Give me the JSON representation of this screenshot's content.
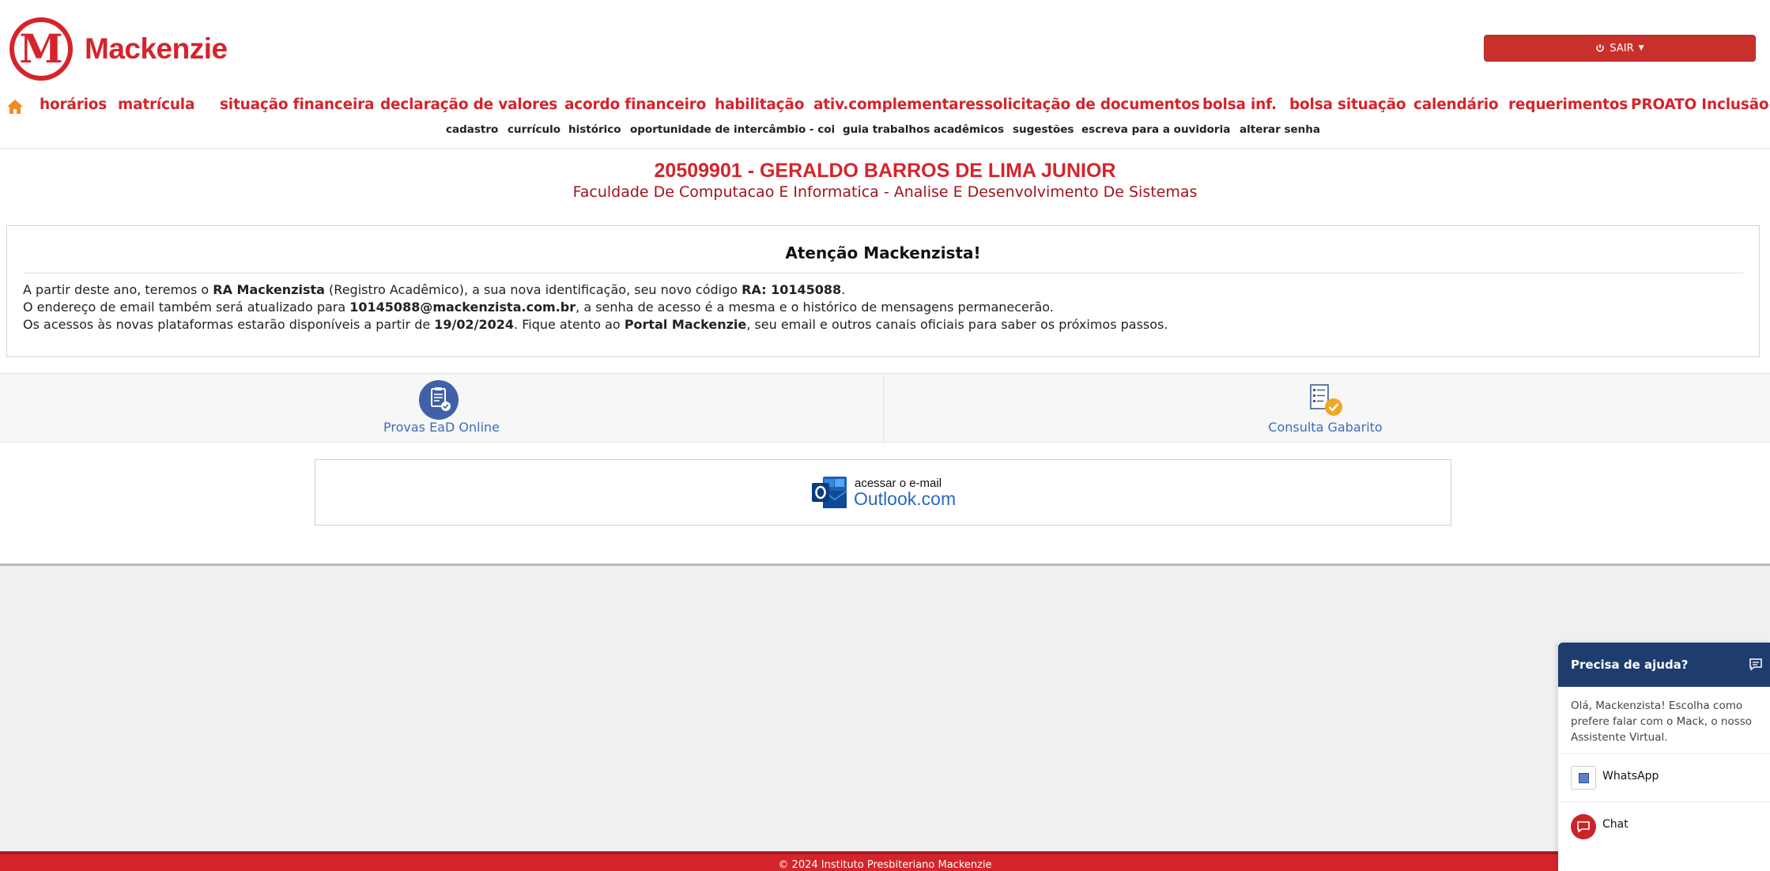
{
  "brand": {
    "name": "Mackenzie",
    "monogram": "M",
    "color": "#d5242b"
  },
  "header": {
    "logout_label": "SAIR"
  },
  "nav": {
    "main": [
      "horários",
      "matrícula",
      "situação financeira",
      "declaração de valores",
      "acordo financeiro",
      "habilitação",
      "ativ.complementares",
      "solicitação de documentos",
      "bolsa inf.",
      "bolsa situação",
      "calendário",
      "requerimentos",
      "PROATO Inclusão"
    ],
    "sub": [
      "cadastro",
      "currículo",
      "histórico",
      "oportunidade de intercâmbio - coi",
      "guia trabalhos acadêmicos",
      "sugestões",
      "escreva para a ouvidoria",
      "alterar senha"
    ]
  },
  "student": {
    "name": "20509901 - GERALDO BARROS DE LIMA JUNIOR",
    "course": "Faculdade De Computacao E Informatica - Analise E Desenvolvimento De Sistemas"
  },
  "notice": {
    "title": "Atenção Mackenzista!",
    "line1": {
      "a": "A partir deste ano, teremos o ",
      "b": "RA Mackenzista",
      "c": " (Registro Acadêmico), a sua nova identificação, seu novo código ",
      "d": "RA: 10145088",
      "e": "."
    },
    "line2": {
      "a": "O endereço de email também será atualizado para ",
      "b": "10145088@mackenzista.com.br",
      "c": ", a senha de acesso é a mesma e o histórico de mensagens permanecerão."
    },
    "line3": {
      "a": "Os acessos às novas plataformas estarão disponíveis a partir de ",
      "b": "19/02/2024",
      "c": ". Fique atento ao ",
      "d": "Portal Mackenzie",
      "e": ", seu email e outros canais oficiais para saber os próximos passos."
    }
  },
  "actions": {
    "provas": "Provas EaD Online",
    "gabarito": "Consulta Gabarito"
  },
  "outlook": {
    "small": "acessar o e-mail",
    "big": "Outlook.com"
  },
  "footer": {
    "text": "© 2024 Instituto Presbiteriano Mackenzie"
  },
  "help": {
    "title": "Precisa de ajuda?",
    "intro": "Olá, Mackenzista! Escolha como prefere falar com o Mack, o nosso Assistente Virtual.",
    "whatsapp": "WhatsApp",
    "chat": "Chat"
  }
}
